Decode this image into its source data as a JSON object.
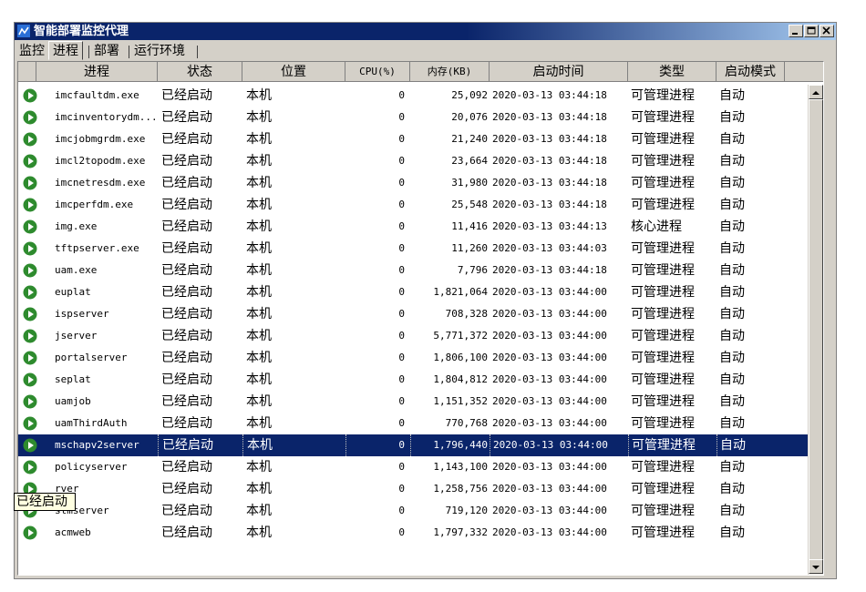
{
  "window": {
    "title": "智能部署监控代理",
    "controls": [
      "minimize-icon",
      "maximize-icon",
      "close-icon"
    ]
  },
  "tabs": [
    {
      "label": "监控"
    },
    {
      "label": "进程",
      "active": true
    },
    {
      "label": "部署"
    },
    {
      "label": "运行环境"
    }
  ],
  "table": {
    "columns": [
      "进程",
      "状态",
      "位置",
      "CPU(%)",
      "内存(KB)",
      "启动时间",
      "类型",
      "启动模式"
    ],
    "rows": [
      {
        "name": "imcfaultdm.exe",
        "status": "已经启动",
        "location": "本机",
        "cpu": "0",
        "mem": "25,092",
        "start": "2020-03-13 03:44:18",
        "type": "可管理进程",
        "mode": "自动"
      },
      {
        "name": "imcinventorydm...",
        "status": "已经启动",
        "location": "本机",
        "cpu": "0",
        "mem": "20,076",
        "start": "2020-03-13 03:44:18",
        "type": "可管理进程",
        "mode": "自动"
      },
      {
        "name": "imcjobmgrdm.exe",
        "status": "已经启动",
        "location": "本机",
        "cpu": "0",
        "mem": "21,240",
        "start": "2020-03-13 03:44:18",
        "type": "可管理进程",
        "mode": "自动"
      },
      {
        "name": "imcl2topodm.exe",
        "status": "已经启动",
        "location": "本机",
        "cpu": "0",
        "mem": "23,664",
        "start": "2020-03-13 03:44:18",
        "type": "可管理进程",
        "mode": "自动"
      },
      {
        "name": "imcnetresdm.exe",
        "status": "已经启动",
        "location": "本机",
        "cpu": "0",
        "mem": "31,980",
        "start": "2020-03-13 03:44:18",
        "type": "可管理进程",
        "mode": "自动"
      },
      {
        "name": "imcperfdm.exe",
        "status": "已经启动",
        "location": "本机",
        "cpu": "0",
        "mem": "25,548",
        "start": "2020-03-13 03:44:18",
        "type": "可管理进程",
        "mode": "自动"
      },
      {
        "name": "img.exe",
        "status": "已经启动",
        "location": "本机",
        "cpu": "0",
        "mem": "11,416",
        "start": "2020-03-13 03:44:13",
        "type": "核心进程",
        "mode": "自动"
      },
      {
        "name": "tftpserver.exe",
        "status": "已经启动",
        "location": "本机",
        "cpu": "0",
        "mem": "11,260",
        "start": "2020-03-13 03:44:03",
        "type": "可管理进程",
        "mode": "自动"
      },
      {
        "name": "uam.exe",
        "status": "已经启动",
        "location": "本机",
        "cpu": "0",
        "mem": "7,796",
        "start": "2020-03-13 03:44:18",
        "type": "可管理进程",
        "mode": "自动"
      },
      {
        "name": "euplat",
        "status": "已经启动",
        "location": "本机",
        "cpu": "0",
        "mem": "1,821,064",
        "start": "2020-03-13 03:44:00",
        "type": "可管理进程",
        "mode": "自动"
      },
      {
        "name": "ispserver",
        "status": "已经启动",
        "location": "本机",
        "cpu": "0",
        "mem": "708,328",
        "start": "2020-03-13 03:44:00",
        "type": "可管理进程",
        "mode": "自动"
      },
      {
        "name": "jserver",
        "status": "已经启动",
        "location": "本机",
        "cpu": "0",
        "mem": "5,771,372",
        "start": "2020-03-13 03:44:00",
        "type": "可管理进程",
        "mode": "自动"
      },
      {
        "name": "portalserver",
        "status": "已经启动",
        "location": "本机",
        "cpu": "0",
        "mem": "1,806,100",
        "start": "2020-03-13 03:44:00",
        "type": "可管理进程",
        "mode": "自动"
      },
      {
        "name": "seplat",
        "status": "已经启动",
        "location": "本机",
        "cpu": "0",
        "mem": "1,804,812",
        "start": "2020-03-13 03:44:00",
        "type": "可管理进程",
        "mode": "自动"
      },
      {
        "name": "uamjob",
        "status": "已经启动",
        "location": "本机",
        "cpu": "0",
        "mem": "1,151,352",
        "start": "2020-03-13 03:44:00",
        "type": "可管理进程",
        "mode": "自动"
      },
      {
        "name": "uamThirdAuth",
        "status": "已经启动",
        "location": "本机",
        "cpu": "0",
        "mem": "770,768",
        "start": "2020-03-13 03:44:00",
        "type": "可管理进程",
        "mode": "自动"
      },
      {
        "name": "mschapv2server",
        "status": "已经启动",
        "location": "本机",
        "cpu": "0",
        "mem": "1,796,440",
        "start": "2020-03-13 03:44:00",
        "type": "可管理进程",
        "mode": "自动",
        "selected": true
      },
      {
        "name": "policyserver",
        "status": "已经启动",
        "location": "本机",
        "cpu": "0",
        "mem": "1,143,100",
        "start": "2020-03-13 03:44:00",
        "type": "可管理进程",
        "mode": "自动"
      },
      {
        "name": "rver",
        "status": "已经启动",
        "location": "本机",
        "cpu": "0",
        "mem": "1,258,756",
        "start": "2020-03-13 03:44:00",
        "type": "可管理进程",
        "mode": "自动"
      },
      {
        "name": "stmserver",
        "status": "已经启动",
        "location": "本机",
        "cpu": "0",
        "mem": "719,120",
        "start": "2020-03-13 03:44:00",
        "type": "可管理进程",
        "mode": "自动"
      },
      {
        "name": "acmweb",
        "status": "已经启动",
        "location": "本机",
        "cpu": "0",
        "mem": "1,797,332",
        "start": "2020-03-13 03:44:00",
        "type": "可管理进程",
        "mode": "自动"
      }
    ]
  },
  "tooltip": {
    "text": "已经启动"
  },
  "colors": {
    "titlebar": "#0a246a",
    "selection": "#0a246a",
    "running_icon": "#2e8b2e"
  }
}
